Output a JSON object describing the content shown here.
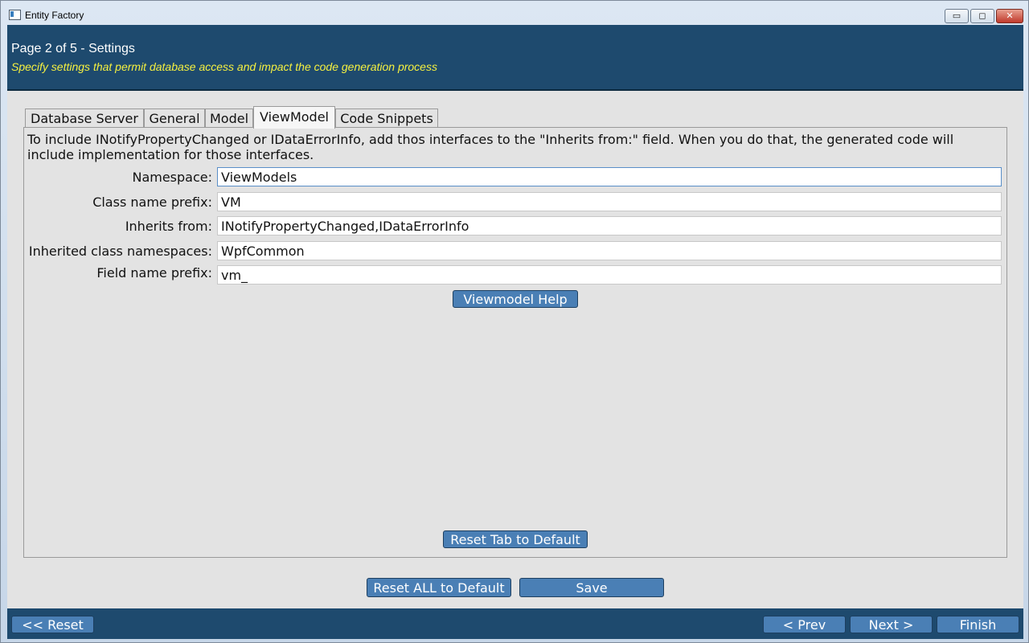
{
  "window": {
    "title": "Entity Factory",
    "min_glyph": "▭",
    "max_glyph": "◻",
    "close_glyph": "✕"
  },
  "header": {
    "title": "Page 2 of 5 - Settings",
    "subtitle": "Specify settings that permit database access and impact the code generation process"
  },
  "tabs": [
    {
      "label": "Database Server"
    },
    {
      "label": "General"
    },
    {
      "label": "Model"
    },
    {
      "label": "ViewModel",
      "active": true
    },
    {
      "label": "Code Snippets"
    }
  ],
  "viewmodel": {
    "info": "To include INotifyPropertyChanged or IDataErrorInfo, add thos interfaces to the \"Inherits from:\" field. When you do that, the generated code will include implementation for those interfaces.",
    "fields": [
      {
        "label": "Namespace:",
        "value": "ViewModels"
      },
      {
        "label": "Class name prefix:",
        "value": "VM"
      },
      {
        "label": "Inherits from:",
        "value": "INotifyPropertyChanged,IDataErrorInfo"
      },
      {
        "label": "Inherited class namespaces:",
        "value": "WpfCommon"
      },
      {
        "label": "Field name prefix:",
        "value": "vm_"
      }
    ],
    "help_button": "Viewmodel Help",
    "reset_tab_button": "Reset Tab to Default"
  },
  "actions": {
    "reset_all": "Reset ALL to Default",
    "save": "Save"
  },
  "nav": {
    "reset": "<< Reset",
    "prev": "< Prev",
    "next": "Next >",
    "finish": "Finish"
  },
  "colors": {
    "header_bg": "#1e4a6e",
    "subtitle": "#f5f040",
    "button_bg": "#4a7fb5"
  }
}
